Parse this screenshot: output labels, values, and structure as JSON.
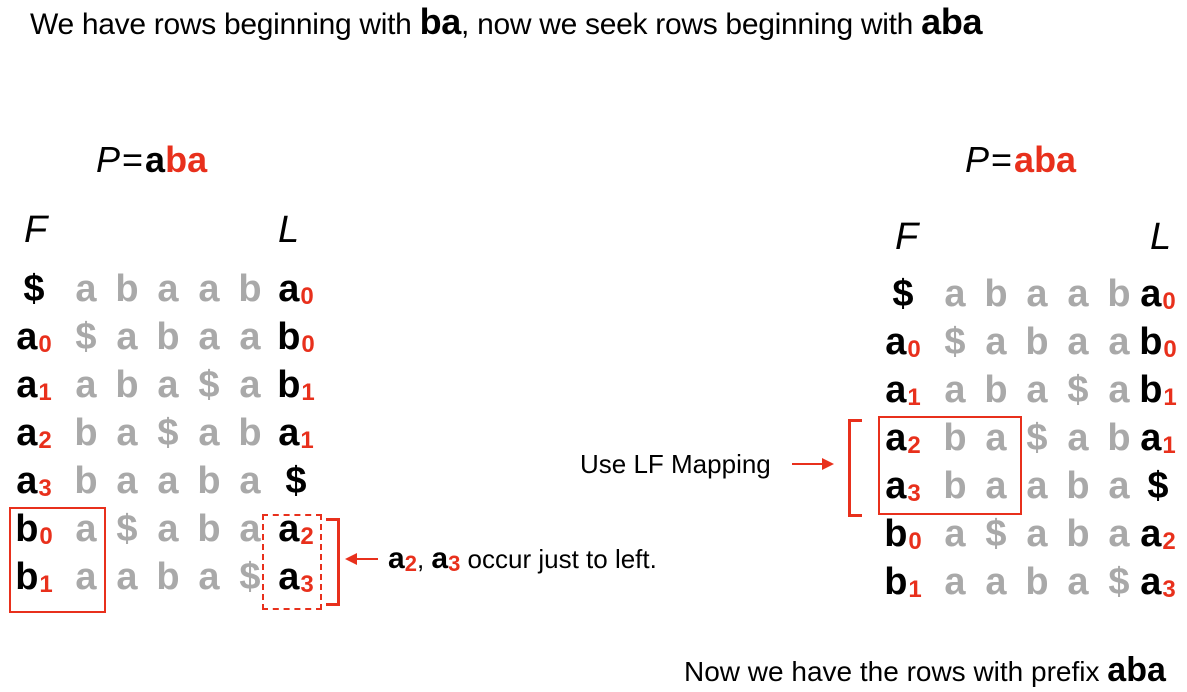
{
  "title": {
    "prefix": "We have rows beginning with ",
    "known": "ba",
    "middle": ", now we seek rows beginning with ",
    "seek_a": "a",
    "seek_ba": "ba"
  },
  "left": {
    "pattern_label": "P",
    "pattern_eq": "=",
    "pattern_a": "a",
    "pattern_ba": "ba",
    "f_header": "F",
    "l_header": "L",
    "rows": [
      {
        "f": "$",
        "f_sub": "",
        "mid": [
          "a",
          "b",
          "a",
          "a",
          "b"
        ],
        "l": "a",
        "l_sub": "0"
      },
      {
        "f": "a",
        "f_sub": "0",
        "mid": [
          "$",
          "a",
          "b",
          "a",
          "a"
        ],
        "l": "b",
        "l_sub": "0"
      },
      {
        "f": "a",
        "f_sub": "1",
        "mid": [
          "a",
          "b",
          "a",
          "$",
          "a"
        ],
        "l": "b",
        "l_sub": "1"
      },
      {
        "f": "a",
        "f_sub": "2",
        "mid": [
          "b",
          "a",
          "$",
          "a",
          "b"
        ],
        "l": "a",
        "l_sub": "1"
      },
      {
        "f": "a",
        "f_sub": "3",
        "mid": [
          "b",
          "a",
          "a",
          "b",
          "a"
        ],
        "l": "$",
        "l_sub": ""
      },
      {
        "f": "b",
        "f_sub": "0",
        "mid": [
          "a",
          "$",
          "a",
          "b",
          "a"
        ],
        "l": "a",
        "l_sub": "2"
      },
      {
        "f": "b",
        "f_sub": "1",
        "mid": [
          "a",
          "a",
          "b",
          "a",
          "$"
        ],
        "l": "a",
        "l_sub": "3"
      }
    ],
    "note": {
      "a": "a",
      "sub2": "2",
      "comma": ", ",
      "a2": "a",
      "sub3": "3",
      "text": " occur just to left."
    }
  },
  "right": {
    "pattern_label": "P",
    "pattern_eq": "=",
    "pattern": "aba",
    "f_header": "F",
    "l_header": "L",
    "rows": [
      {
        "f": "$",
        "f_sub": "",
        "mid": [
          "a",
          "b",
          "a",
          "a",
          "b"
        ],
        "l": "a",
        "l_sub": "0"
      },
      {
        "f": "a",
        "f_sub": "0",
        "mid": [
          "$",
          "a",
          "b",
          "a",
          "a"
        ],
        "l": "b",
        "l_sub": "0"
      },
      {
        "f": "a",
        "f_sub": "1",
        "mid": [
          "a",
          "b",
          "a",
          "$",
          "a"
        ],
        "l": "b",
        "l_sub": "1"
      },
      {
        "f": "a",
        "f_sub": "2",
        "mid": [
          "b",
          "a",
          "$",
          "a",
          "b"
        ],
        "l": "a",
        "l_sub": "1"
      },
      {
        "f": "a",
        "f_sub": "3",
        "mid": [
          "b",
          "a",
          "a",
          "b",
          "a"
        ],
        "l": "$",
        "l_sub": ""
      },
      {
        "f": "b",
        "f_sub": "0",
        "mid": [
          "a",
          "$",
          "a",
          "b",
          "a"
        ],
        "l": "a",
        "l_sub": "2"
      },
      {
        "f": "b",
        "f_sub": "1",
        "mid": [
          "a",
          "a",
          "b",
          "a",
          "$"
        ],
        "l": "a",
        "l_sub": "3"
      }
    ],
    "lf_label": "Use LF Mapping"
  },
  "footer": {
    "text": "Now we have the rows with prefix ",
    "bold": "aba"
  },
  "colors": {
    "accent": "#e8301c",
    "faded": "#a9a9a9",
    "text": "#000000"
  }
}
